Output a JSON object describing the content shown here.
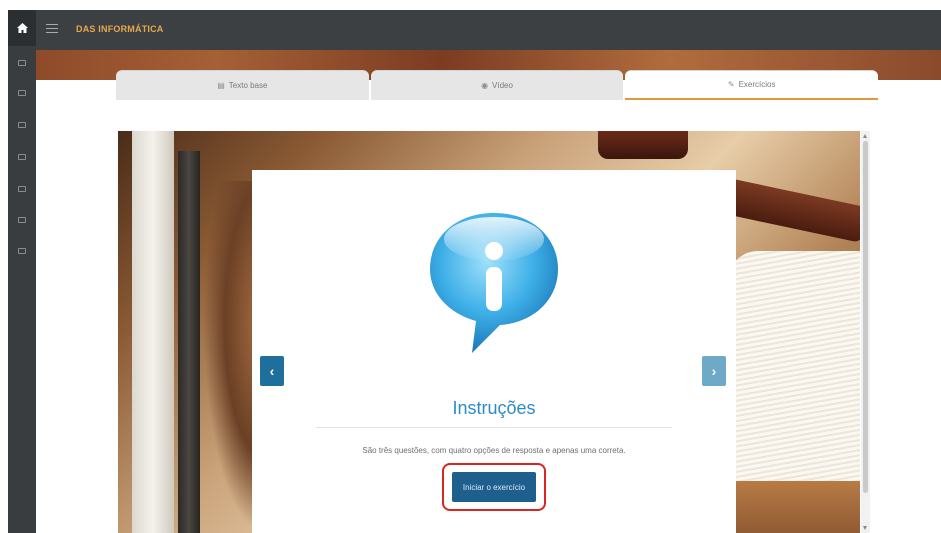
{
  "app": {
    "title": "DAS INFORMÁTICA",
    "home_icon": "home-icon",
    "menu_icon": "hamburger-icon",
    "accent_color": "#e09a3d",
    "primary_color": "#1f5f8e"
  },
  "tabs": [
    {
      "label": "Texto base",
      "icon": "document-icon",
      "active": false
    },
    {
      "label": "Vídeo",
      "icon": "play-icon",
      "active": false
    },
    {
      "label": "Exercícios",
      "icon": "edit-icon",
      "active": true
    }
  ],
  "card": {
    "icon": "info-bubble-icon",
    "title": "Instruções",
    "description": "São três questões, com quatro opções de resposta e apenas uma correta.",
    "start_button": "Iniciar o exercício"
  },
  "carousel": {
    "prev_icon": "chevron-left-icon",
    "next_icon": "chevron-right-icon",
    "prev_glyph": "‹",
    "next_glyph": "›"
  }
}
